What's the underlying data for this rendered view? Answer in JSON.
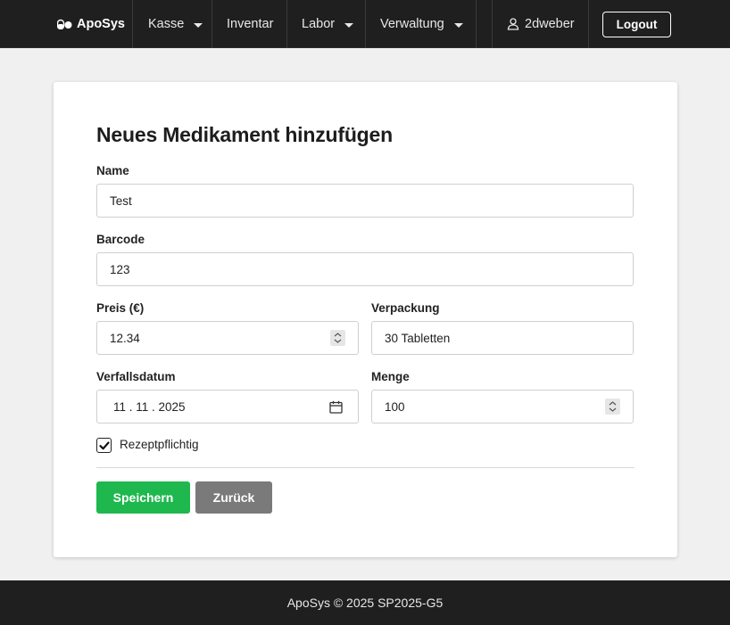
{
  "navbar": {
    "brand": "ApoSys",
    "items": [
      {
        "label": "Kasse"
      },
      {
        "label": "Inventar"
      },
      {
        "label": "Labor"
      },
      {
        "label": "Verwaltung"
      }
    ],
    "user": "2dweber",
    "logout_label": "Logout",
    "icons": {
      "brand": "pills-icon",
      "user": "user-icon",
      "caret": "caret-down-icon"
    },
    "colors": {
      "background": "#1f1f1f",
      "text": "#e8e8e8"
    }
  },
  "form": {
    "title": "Neues Medikament hinzufügen",
    "name_label": "Name",
    "name_value": "Test",
    "barcode_label": "Barcode",
    "barcode_value": "123",
    "price_label": "Preis (€)",
    "price_value": "12.34",
    "packaging_label": "Verpackung",
    "packaging_value": "30 Tabletten",
    "expiry_label": "Verfallsdatum",
    "expiry_value": "11 . 11 . 2025",
    "quantity_label": "Menge",
    "quantity_value": "100",
    "prescription_label": "Rezeptpflichtig",
    "prescription_checked": true,
    "save_label": "Speichern",
    "back_label": "Zurück",
    "colors": {
      "save": "#1fb84f",
      "back": "#7a7a7a"
    }
  },
  "footer": {
    "text": "ApoSys © 2025 SP2025-G5"
  }
}
